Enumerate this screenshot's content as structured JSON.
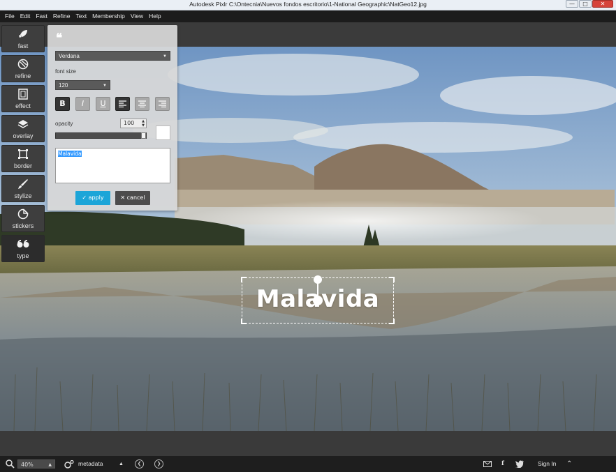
{
  "window": {
    "title": "Autodesk Pixlr   C:\\Ontecnia\\Nuevos fondos escritorio\\1-National Geographic\\NatGeo12.jpg",
    "minimize": "—",
    "maximize": "□",
    "close": "✕"
  },
  "menu": [
    "File",
    "Edit",
    "Fast",
    "Refine",
    "Text",
    "Membership",
    "View",
    "Help"
  ],
  "tools": [
    {
      "label": "fast",
      "icon": "rocket-icon"
    },
    {
      "label": "refine",
      "icon": "aperture-icon"
    },
    {
      "label": "effect",
      "icon": "film-icon"
    },
    {
      "label": "overlay",
      "icon": "layers-icon"
    },
    {
      "label": "border",
      "icon": "frame-icon"
    },
    {
      "label": "stylize",
      "icon": "brush-icon"
    },
    {
      "label": "stickers",
      "icon": "sticker-icon"
    },
    {
      "label": "type",
      "icon": "quote-icon"
    }
  ],
  "active_tool": "type",
  "type_panel": {
    "header_glyph": "❝",
    "font": "Verdana",
    "font_size_label": "font size",
    "font_size": "120",
    "format_buttons": [
      "B",
      "I",
      "U"
    ],
    "opacity_label": "opacity",
    "opacity": "100",
    "color": "#ffffff",
    "text": "Malavida",
    "apply_label": "apply",
    "cancel_label": "cancel"
  },
  "canvas_text": "Malavida",
  "status": {
    "zoom": "40%",
    "metadata_label": "metadata",
    "signin_label": "Sign In"
  },
  "colors": {
    "accent": "#1ca5d8",
    "menubar": "#1c1c1c",
    "panel": "#d8d8d8"
  }
}
